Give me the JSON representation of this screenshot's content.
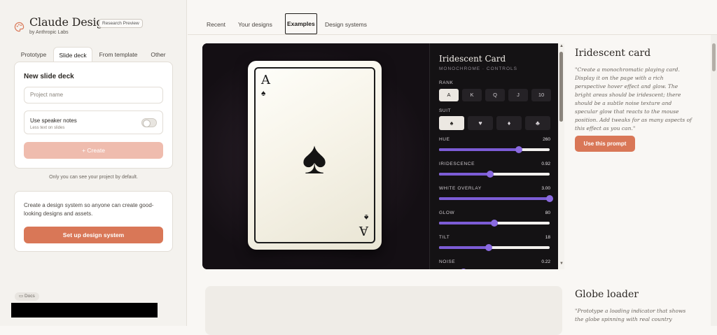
{
  "sidebar": {
    "brand": "Claude Design",
    "badge": "Research Preview",
    "byline": "by Anthropic Labs",
    "mode_tabs": [
      "Prototype",
      "Slide deck",
      "From template",
      "Other"
    ],
    "active_mode": "Slide deck",
    "new_deck": {
      "title": "New slide deck",
      "project_placeholder": "Project name",
      "notes_label": "Use speaker notes",
      "notes_sub": "Less text on slides",
      "notes_enabled": false,
      "create_label": "Create"
    },
    "visibility_note": "Only you can see your project by default.",
    "design_system": {
      "text": "Create a design system so anyone can create good-looking designs and assets.",
      "button_label": "Set up design system"
    },
    "docs_label": "Docs"
  },
  "main": {
    "tabs": [
      "Recent",
      "Your designs",
      "Examples",
      "Design systems"
    ],
    "active_tab": "Examples",
    "examples": [
      {
        "title": "Iridescent card",
        "description": "\"Create a monochromatic playing card. Display it on the page with a rich perspective hover effect and glow. The bright areas should be iridescent; there should be a subtle noise texture and specular glow that reacts to the mouse position. Add tweaks for as many aspects of this effect as you can.\"",
        "button_label": "Use this prompt"
      },
      {
        "title": "Globe loader",
        "description": "\"Prototype a loading indicator that shows the globe spinning with real country"
      }
    ]
  },
  "preview": {
    "card": {
      "rank": "A",
      "suit_glyph": "♠"
    },
    "controls": {
      "title": "Iridescent Card",
      "subtitle": "MONOCHROME · CONTROLS",
      "rank_label": "RANK",
      "ranks": [
        "A",
        "K",
        "Q",
        "J",
        "10"
      ],
      "selected_rank": "A",
      "suit_label": "SUIT",
      "suits": [
        "♠",
        "♥",
        "♦",
        "♣"
      ],
      "selected_suit": "♠",
      "sliders": [
        {
          "label": "HUE",
          "value": "260",
          "fraction": 0.72
        },
        {
          "label": "IRIDESCENCE",
          "value": "0.92",
          "fraction": 0.46
        },
        {
          "label": "WHITE OVERLAY",
          "value": "3.00",
          "fraction": 1.0
        },
        {
          "label": "GLOW",
          "value": "80",
          "fraction": 0.5
        },
        {
          "label": "TILT",
          "value": "18",
          "fraction": 0.45
        },
        {
          "label": "NOISE",
          "value": "0.22",
          "fraction": 0.22
        }
      ]
    }
  },
  "colors": {
    "accent": "#d97757",
    "accent_light": "#efbcae",
    "slider": "#7c5cd6"
  }
}
